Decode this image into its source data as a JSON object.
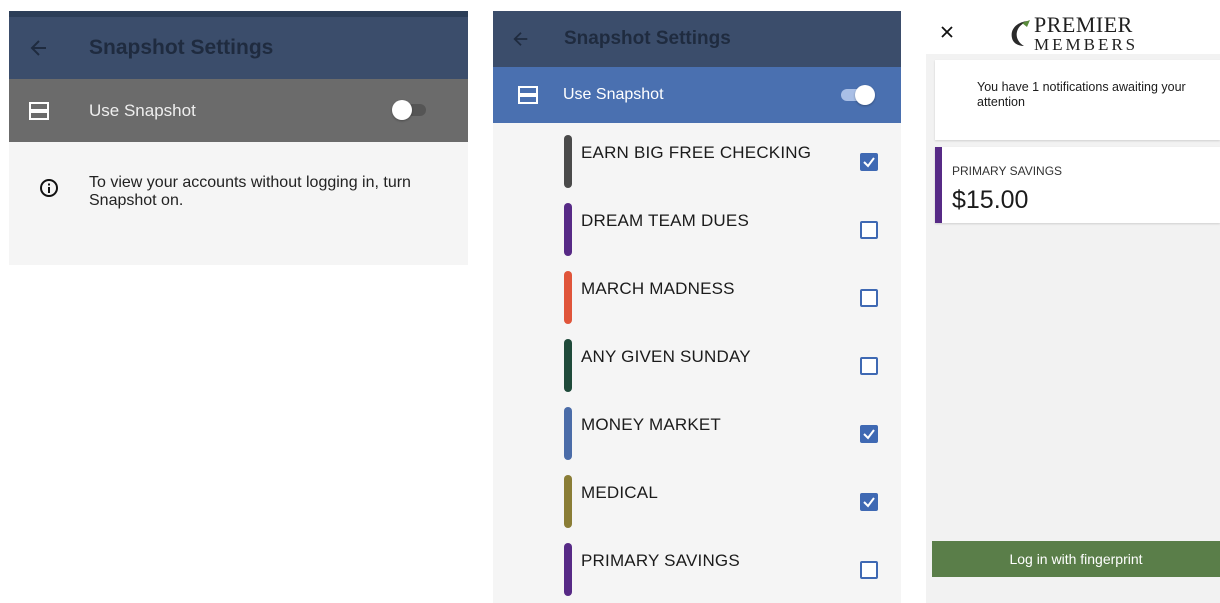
{
  "colors": {
    "appbar": "#3b4d6b",
    "appbar_title": "#1f2b3f",
    "toggle_row_off": "#6b6b6b",
    "toggle_row_on": "#4a70b0",
    "checkbox": "#3f69b3",
    "fingerprint_button": "#5a7e49"
  },
  "screen_off": {
    "title": "Snapshot Settings",
    "back_icon": "arrow-left-icon",
    "toggle_icon": "list-rows-icon",
    "toggle_label": "Use Snapshot",
    "toggle_on": false,
    "info_icon": "info-circle-icon",
    "info_text": "To view your accounts without logging in, turn Snapshot on."
  },
  "screen_on": {
    "title": "Snapshot Settings",
    "back_icon": "arrow-left-icon",
    "toggle_icon": "list-rows-icon",
    "toggle_label": "Use Snapshot",
    "toggle_on": true,
    "accounts": [
      {
        "name": "EARN BIG FREE CHECKING",
        "color": "#4a4a4a",
        "checked": true
      },
      {
        "name": "DREAM TEAM DUES",
        "color": "#572a86",
        "checked": false
      },
      {
        "name": "MARCH MADNESS",
        "color": "#e0553a",
        "checked": false
      },
      {
        "name": "ANY GIVEN SUNDAY",
        "color": "#1f4a3a",
        "checked": false
      },
      {
        "name": "MONEY MARKET",
        "color": "#4b6ca8",
        "checked": true
      },
      {
        "name": "MEDICAL",
        "color": "#8a7d36",
        "checked": true
      },
      {
        "name": "PRIMARY SAVINGS",
        "color": "#572a86",
        "checked": false
      }
    ]
  },
  "snapshot_view": {
    "close_icon": "close-icon",
    "logo": {
      "line1": "PREMIER",
      "line2": "MEMBERS"
    },
    "notification": "You have 1 notifications awaiting your attention",
    "account": {
      "name": "PRIMARY SAVINGS",
      "amount": "$15.00",
      "color": "#572a86"
    },
    "login_button": "Log in with fingerprint"
  }
}
